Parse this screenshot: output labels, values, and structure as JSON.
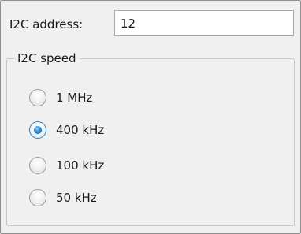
{
  "address": {
    "label": "I2C address:",
    "value": "12"
  },
  "speed": {
    "title": "I2C speed",
    "options": [
      {
        "label": "1 MHz",
        "selected": false
      },
      {
        "label": "400 kHz",
        "selected": true
      },
      {
        "label": "100 kHz",
        "selected": false
      },
      {
        "label": "50 kHz",
        "selected": false
      }
    ]
  },
  "colors": {
    "panel_background": "#f0f0f0",
    "selected_radio": "#2c8ad6"
  }
}
